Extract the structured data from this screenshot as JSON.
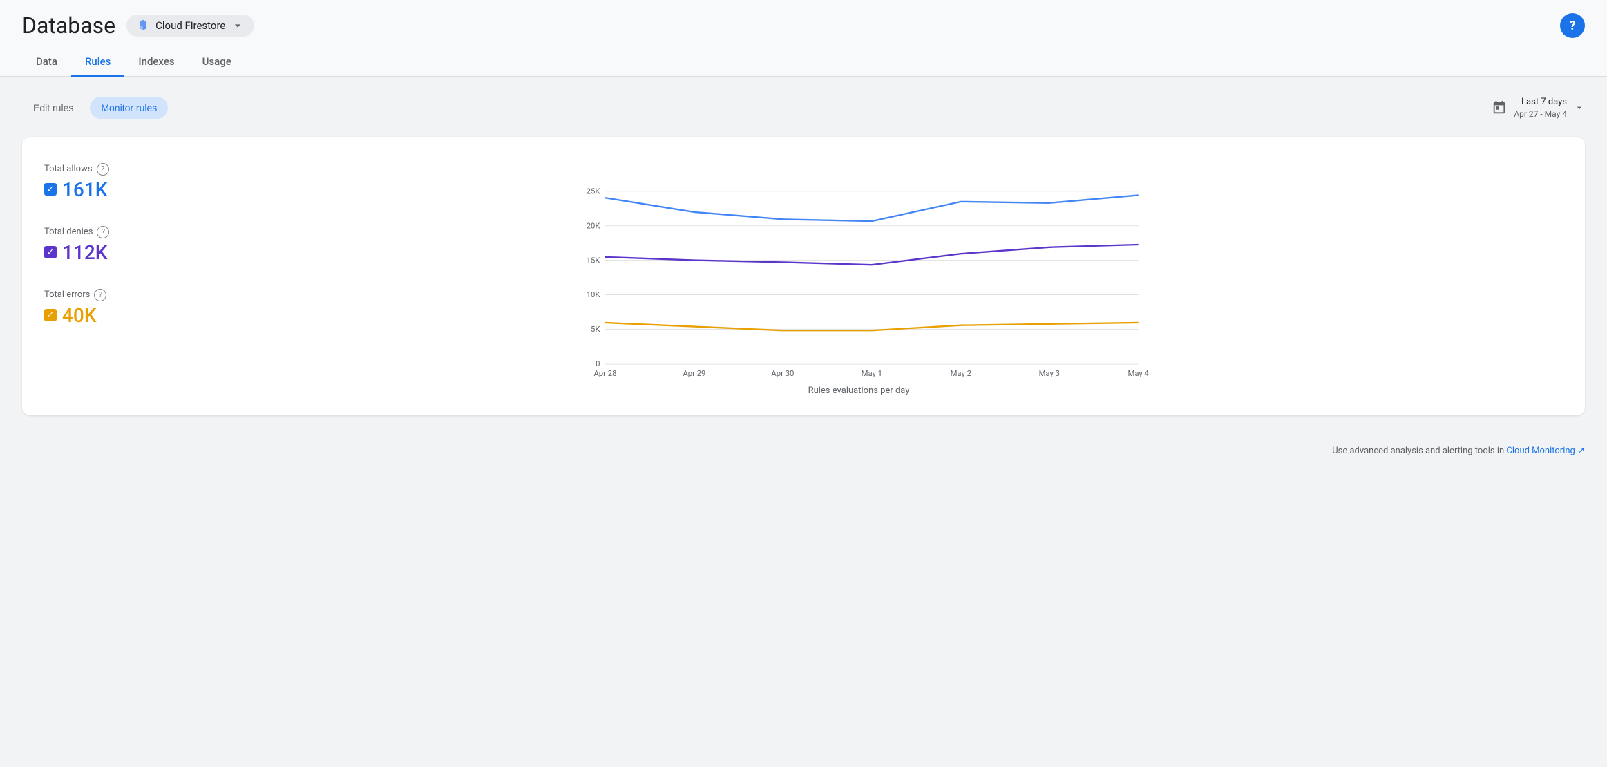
{
  "header": {
    "title": "Database",
    "service": "Cloud Firestore",
    "help_label": "?"
  },
  "nav": {
    "tabs": [
      {
        "label": "Data",
        "active": false
      },
      {
        "label": "Rules",
        "active": true
      },
      {
        "label": "Indexes",
        "active": false
      },
      {
        "label": "Usage",
        "active": false
      }
    ]
  },
  "toolbar": {
    "edit_rules_label": "Edit rules",
    "monitor_rules_label": "Monitor rules",
    "date_range_label": "Last 7 days",
    "date_range_sub": "Apr 27 - May 4"
  },
  "chart": {
    "title": "Rules evaluations per day",
    "y_labels": [
      "0",
      "5K",
      "10K",
      "15K",
      "20K",
      "25K"
    ],
    "x_labels": [
      "Apr 28",
      "Apr 29",
      "Apr 30",
      "May 1",
      "May 2",
      "May 3",
      "May 4"
    ],
    "legend": [
      {
        "label": "Total allows",
        "value": "161K",
        "color": "blue"
      },
      {
        "label": "Total denies",
        "value": "112K",
        "color": "purple"
      },
      {
        "label": "Total errors",
        "value": "40K",
        "color": "yellow"
      }
    ]
  },
  "footer": {
    "note": "Use advanced analysis and alerting tools in",
    "link_text": "Cloud Monitoring",
    "link_icon": "↗"
  }
}
